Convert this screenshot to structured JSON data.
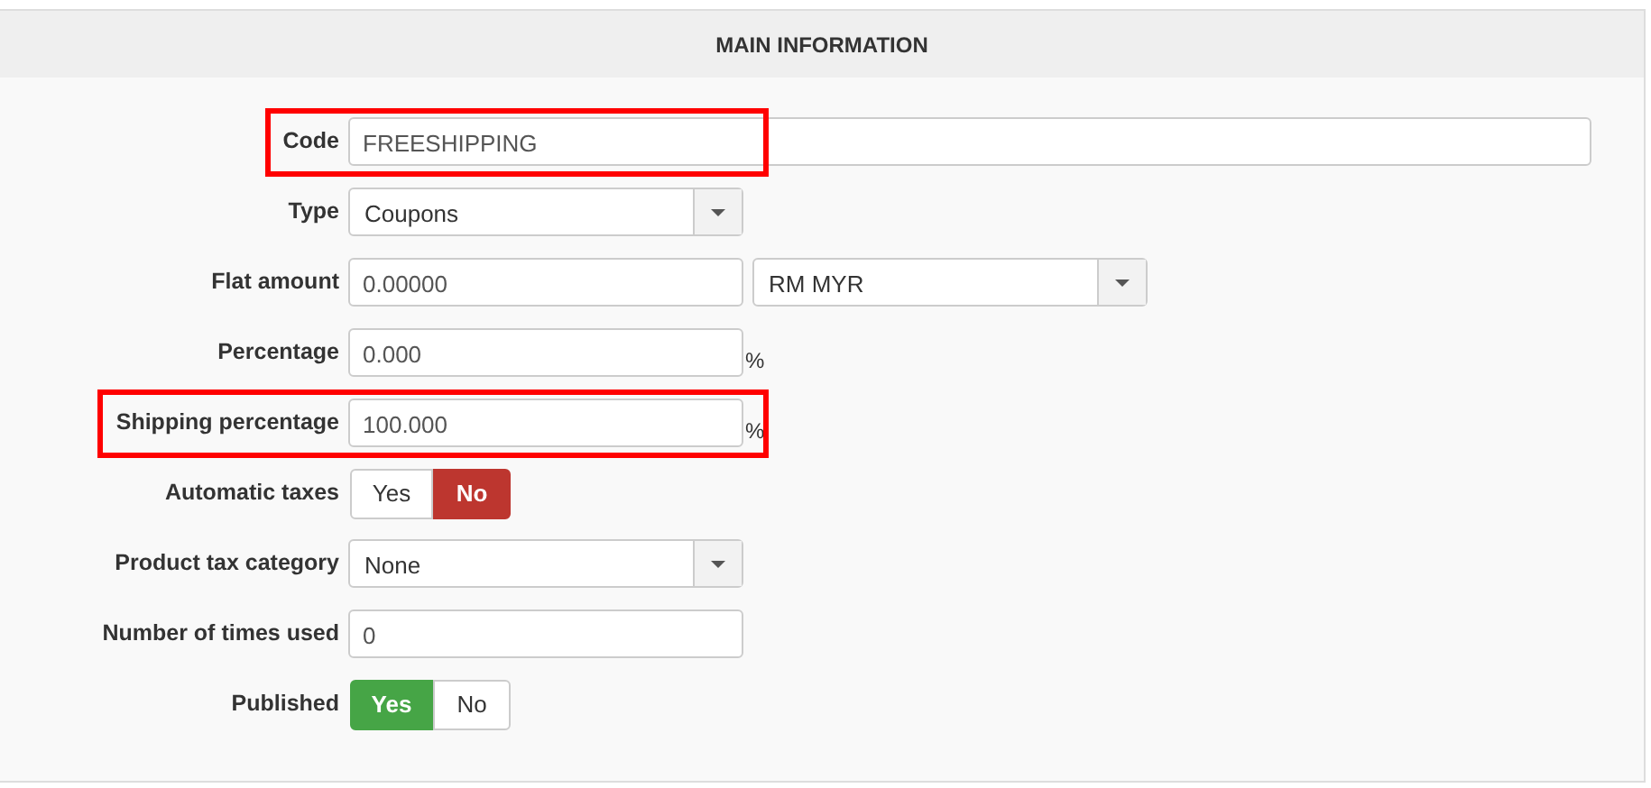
{
  "panel": {
    "title": "MAIN INFORMATION"
  },
  "fields": [
    {
      "label": "Code",
      "kind": "wide_text",
      "value": "FREESHIPPING",
      "highlighted": true
    },
    {
      "label": "Type",
      "kind": "select",
      "value": "Coupons"
    },
    {
      "label": "Flat amount",
      "kind": "amount",
      "value": "0.00000",
      "currency": "RM MYR"
    },
    {
      "label": "Percentage",
      "kind": "percent",
      "value": "0.000",
      "suffix": "%"
    },
    {
      "label": "Shipping percentage",
      "kind": "percent",
      "value": "100.000",
      "suffix": "%",
      "highlighted": true
    },
    {
      "label": "Automatic taxes",
      "kind": "toggle",
      "options": [
        {
          "label": "Yes",
          "selected": false
        },
        {
          "label": "No",
          "selected": true
        }
      ]
    },
    {
      "label": "Product tax category",
      "kind": "select",
      "value": "None"
    },
    {
      "label": "Number of times used",
      "kind": "text",
      "value": "0"
    },
    {
      "label": "Published",
      "kind": "toggle",
      "options": [
        {
          "label": "Yes",
          "selected": true
        },
        {
          "label": "No",
          "selected": false
        }
      ]
    }
  ]
}
